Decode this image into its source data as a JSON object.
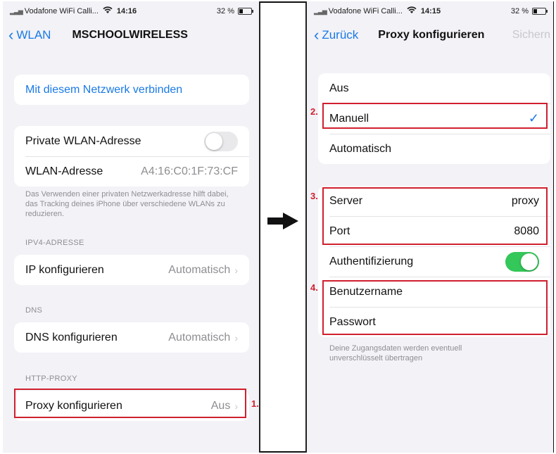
{
  "left_screen": {
    "status": {
      "carrier": "Vodafone WiFi Calli...",
      "time": "14:16",
      "battery": "32 %"
    },
    "nav": {
      "back_label": "WLAN",
      "title": "MSCHOOLWIRELESS"
    },
    "connect_label": "Mit diesem Netzwerk verbinden",
    "private_wlan": {
      "label": "Private WLAN-Adresse",
      "enabled": false
    },
    "wlan_address": {
      "label": "WLAN-Adresse",
      "value": "A4:16:C0:1F:73:CF"
    },
    "private_caption": "Das Verwenden einer privaten Netzwerkadresse hilft dabei, das Tracking deines iPhone über verschiedene WLANs zu reduzieren.",
    "ipv4_header": "IPV4-ADRESSE",
    "ip_config": {
      "label": "IP konfigurieren",
      "value": "Automatisch"
    },
    "dns_header": "DNS",
    "dns_config": {
      "label": "DNS konfigurieren",
      "value": "Automatisch"
    },
    "proxy_header": "HTTP-PROXY",
    "proxy_config": {
      "label": "Proxy konfigurieren",
      "value": "Aus"
    }
  },
  "right_screen": {
    "status": {
      "carrier": "Vodafone WiFi Calli...",
      "time": "14:15",
      "battery": "32 %"
    },
    "nav": {
      "back_label": "Zurück",
      "title": "Proxy konfigurieren",
      "save_label": "Sichern"
    },
    "modes": [
      "Aus",
      "Manuell",
      "Automatisch"
    ],
    "selected_mode": "Manuell",
    "server": {
      "label": "Server",
      "value": "proxy"
    },
    "port": {
      "label": "Port",
      "value": "8080"
    },
    "auth": {
      "label": "Authentifizierung",
      "enabled": true
    },
    "username_label": "Benutzername",
    "password_label": "Passwort",
    "auth_caption": "Deine Zugangsdaten werden eventuell unverschlüsselt übertragen"
  },
  "annotations": {
    "step1": "1.",
    "step2": "2.",
    "step3": "3.",
    "step4": "4."
  },
  "colors": {
    "accent": "#1a7ae6",
    "highlight": "#d0202e",
    "toggle_on": "#34c759"
  }
}
